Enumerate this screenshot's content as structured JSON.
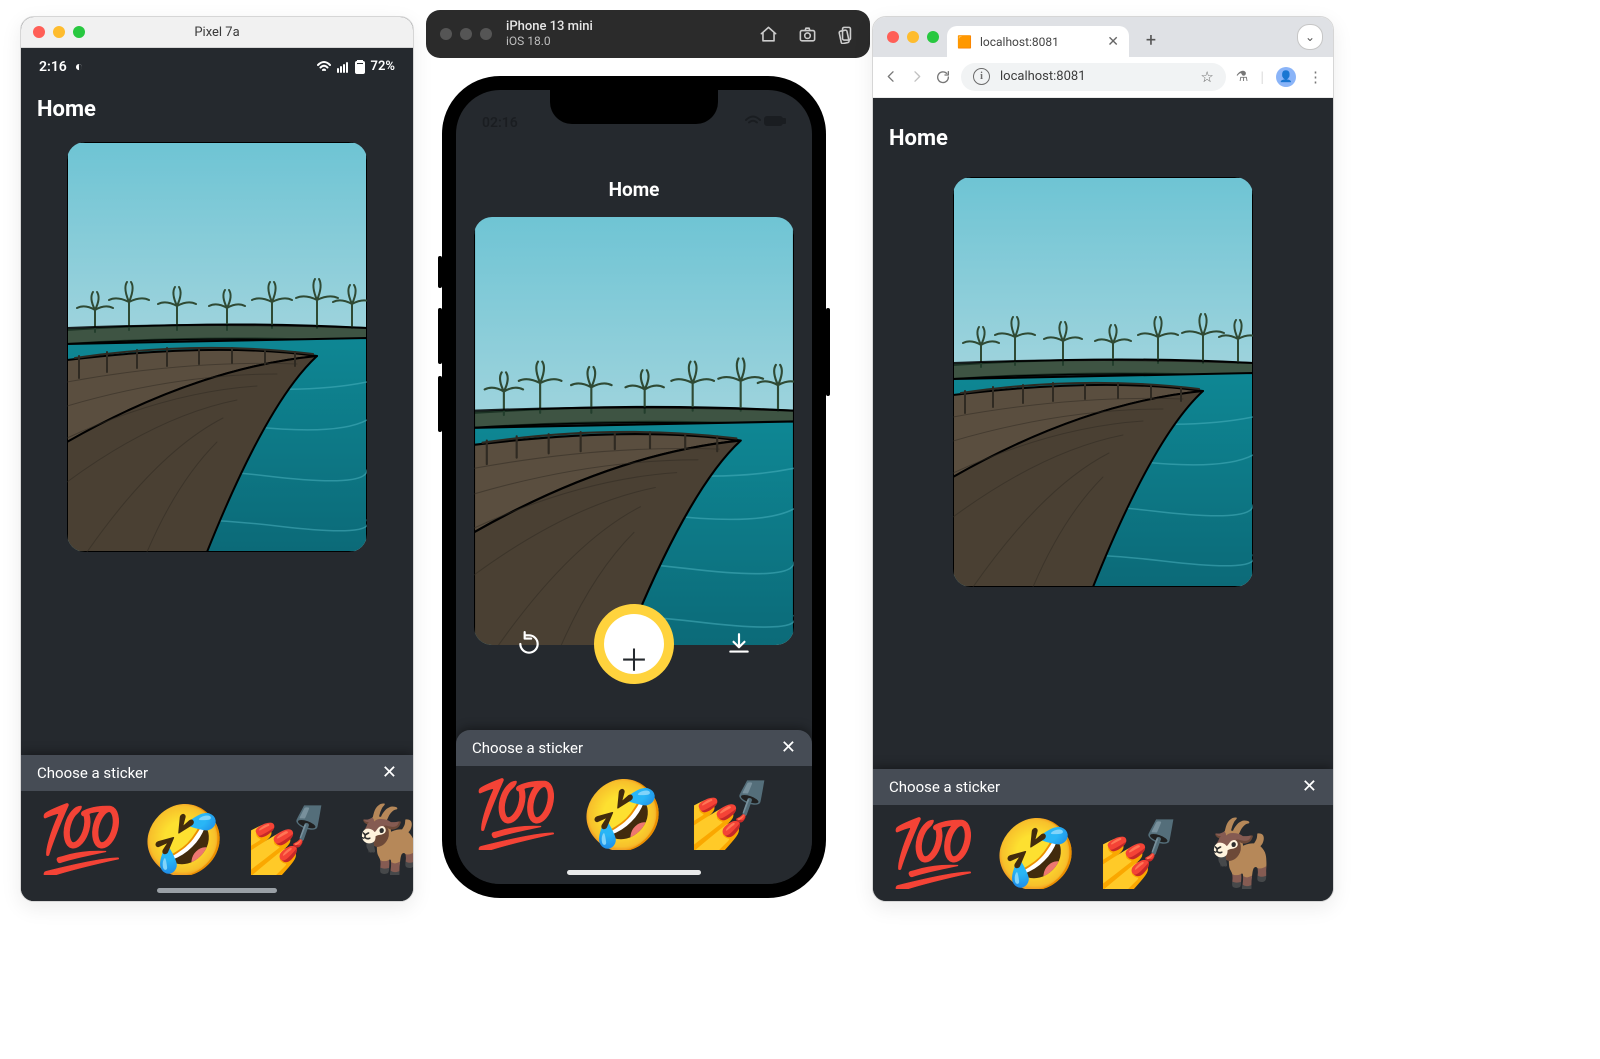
{
  "android": {
    "window_title": "Pixel 7a",
    "status": {
      "time": "2:16",
      "battery": "72%"
    },
    "page_title": "Home",
    "sheet_title": "Choose a sticker",
    "stickers": [
      "💯",
      "🤣",
      "💅",
      "🐐"
    ]
  },
  "ios": {
    "toolbar": {
      "device": "iPhone 13 mini",
      "os": "iOS 18.0"
    },
    "status": {
      "time": "02:16"
    },
    "page_title": "Home",
    "sheet_title": "Choose a sticker",
    "stickers": [
      "💯",
      "🤣",
      "💅"
    ]
  },
  "browser": {
    "tab_title": "localhost:8081",
    "url": "localhost:8081",
    "page_title": "Home",
    "sheet_title": "Choose a sticker",
    "stickers": [
      "💯",
      "🤣",
      "💅",
      "🐐"
    ]
  }
}
